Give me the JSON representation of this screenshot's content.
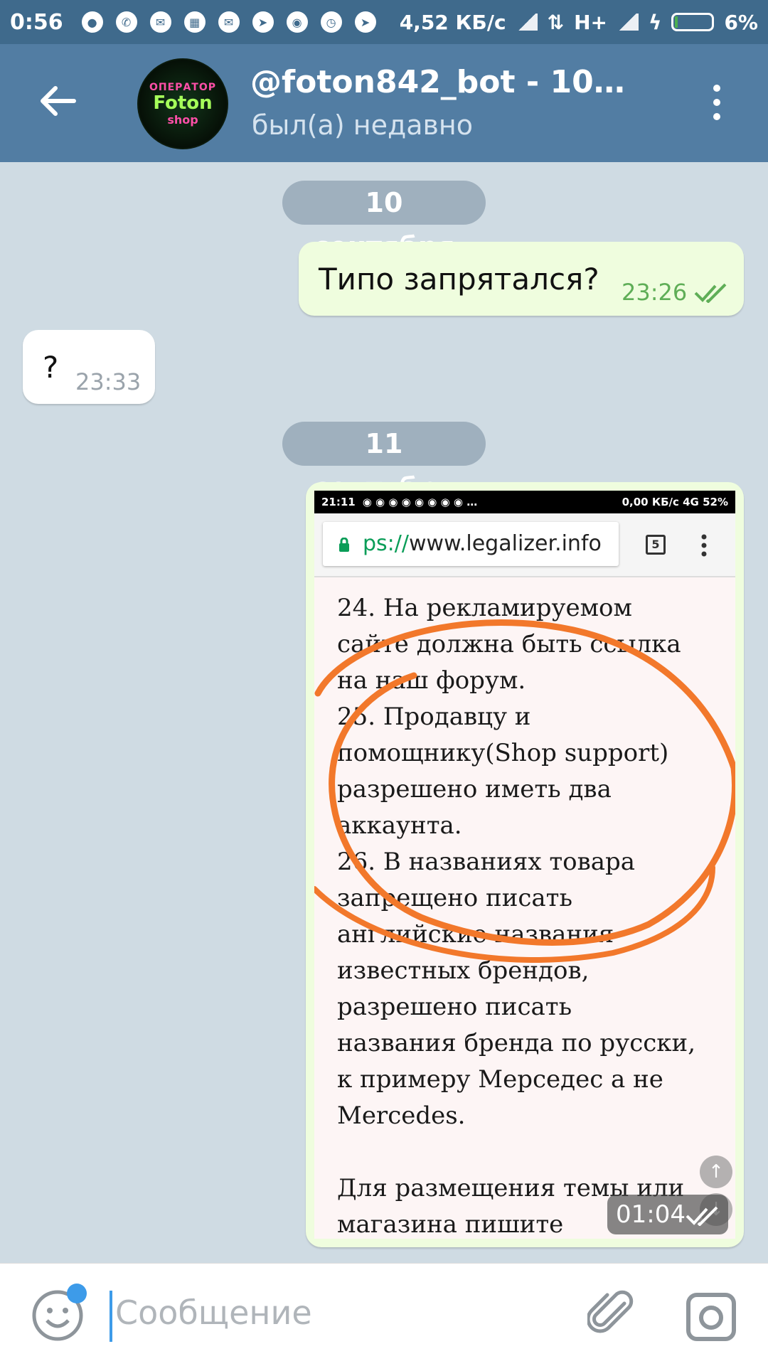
{
  "status_bar": {
    "time": "0:56",
    "speed": "4,52 КБ/с",
    "network": "H+",
    "battery": "6%"
  },
  "header": {
    "title": "@foton842_bot - 10%…",
    "subtitle": "был(а) недавно",
    "avatar": {
      "top": "ОПЕРАТОР",
      "middle": "Foton",
      "bottom": "shop"
    }
  },
  "chat": {
    "date1": "10 сентября",
    "msg1": {
      "text": "Типо запрятался?",
      "time": "23:26"
    },
    "msg2": {
      "text": "?",
      "time": "23:33"
    },
    "date2": "11 сентября",
    "msg3": {
      "time": "01:04",
      "screenshot": {
        "status_time": "21:11",
        "status_right": "0,00 КБ/с  4G  52%",
        "url_prefix": "ps://",
        "url_domain": "www.legalizer.info",
        "tabs_count": "5",
        "lines": [
          "24. На рекламируемом",
          "сайте должна быть ссылка",
          "на наш форум.",
          "25. Продавцу и",
          "помощнику(Shop support)",
          "разрешено иметь два",
          "аккаунта.",
          "26. В названиях товара",
          "запрещено писать",
          "английские названия",
          "известных брендов,",
          "разрешено писать",
          "названия бренда по русски,",
          "к примеру Мерседес а не",
          "Mercedes.",
          "",
          "Для размещения темы или",
          "магазина пишите"
        ]
      }
    }
  },
  "input": {
    "placeholder": "Сообщение"
  },
  "colors": {
    "header": "#527da3",
    "status_bar": "#3f6a8c",
    "outgoing_bubble": "#effdde",
    "incoming_bubble": "#ffffff",
    "annotation": "#f2782b",
    "accent": "#3d9be9"
  }
}
